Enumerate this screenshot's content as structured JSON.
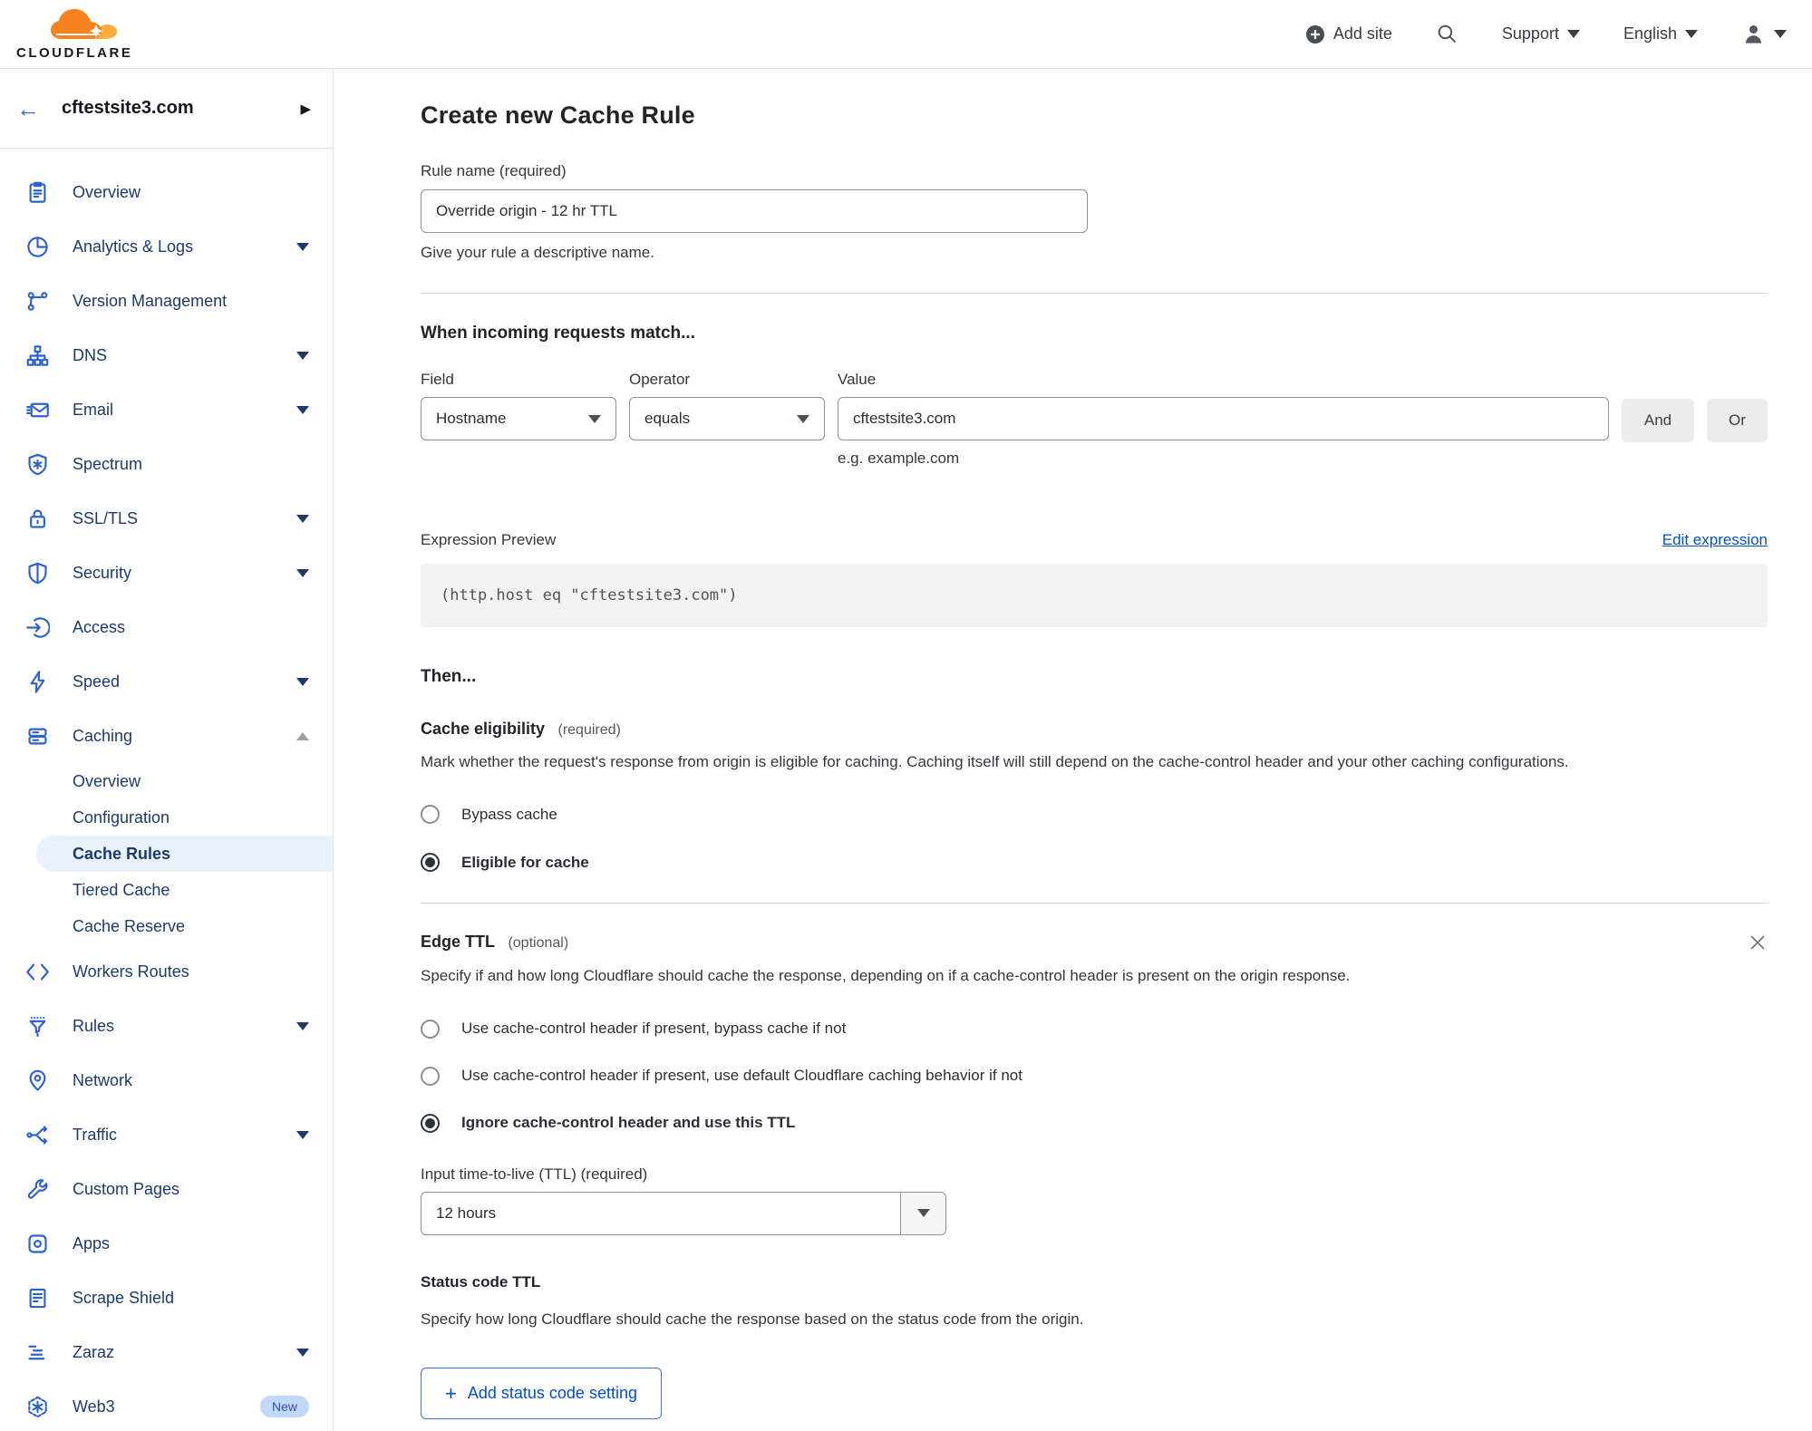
{
  "header": {
    "brand": "CLOUDFLARE",
    "add_site": "Add site",
    "support": "Support",
    "language": "English",
    "icons": {
      "add_site": "plus-circle",
      "search": "magnifier",
      "account": "person",
      "menus": "caret-down"
    }
  },
  "colors": {
    "brand_orange": "#f6821f",
    "brand_orange_light": "#fbad41",
    "link_blue": "#0051c3",
    "nav_text": "#1d3a6d",
    "nav_icon": "#2c63cb",
    "active_item_bg": "#e8f1fc",
    "code_bg": "#f2f2f2"
  },
  "sidebar": {
    "site": "cftestsite3.com",
    "items": [
      {
        "label": "Overview",
        "icon": "clipboard-icon",
        "chevron": "none"
      },
      {
        "label": "Analytics & Logs",
        "icon": "pie-chart-icon",
        "chevron": "down"
      },
      {
        "label": "Version Management",
        "icon": "branch-icon",
        "chevron": "none"
      },
      {
        "label": "DNS",
        "icon": "network-tree-icon",
        "chevron": "down"
      },
      {
        "label": "Email",
        "icon": "envelope-icon",
        "chevron": "down"
      },
      {
        "label": "Spectrum",
        "icon": "shield-asterisk-icon",
        "chevron": "none"
      },
      {
        "label": "SSL/TLS",
        "icon": "padlock-icon",
        "chevron": "down"
      },
      {
        "label": "Security",
        "icon": "shield-icon",
        "chevron": "down"
      },
      {
        "label": "Access",
        "icon": "login-arrow-icon",
        "chevron": "none"
      },
      {
        "label": "Speed",
        "icon": "lightning-icon",
        "chevron": "down"
      },
      {
        "label": "Caching",
        "icon": "server-stack-icon",
        "chevron": "up",
        "expanded": true
      }
    ],
    "caching_sub": [
      {
        "label": "Overview",
        "active": false
      },
      {
        "label": "Configuration",
        "active": false
      },
      {
        "label": "Cache Rules",
        "active": true
      },
      {
        "label": "Tiered Cache",
        "active": false
      },
      {
        "label": "Cache Reserve",
        "active": false
      }
    ],
    "items_after": [
      {
        "label": "Workers Routes",
        "icon": "code-brackets-icon",
        "chevron": "none"
      },
      {
        "label": "Rules",
        "icon": "funnel-icon",
        "chevron": "down"
      },
      {
        "label": "Network",
        "icon": "map-pin-icon",
        "chevron": "none"
      },
      {
        "label": "Traffic",
        "icon": "split-arrows-icon",
        "chevron": "down"
      },
      {
        "label": "Custom Pages",
        "icon": "wrench-icon",
        "chevron": "none"
      },
      {
        "label": "Apps",
        "icon": "app-icon",
        "chevron": "none"
      },
      {
        "label": "Scrape Shield",
        "icon": "document-icon",
        "chevron": "none"
      },
      {
        "label": "Zaraz",
        "icon": "bars-icon",
        "chevron": "down"
      },
      {
        "label": "Web3",
        "icon": "hexagon-icon",
        "chevron": "none",
        "badge": "New"
      }
    ]
  },
  "main": {
    "title": "Create new Cache Rule",
    "rule_name": {
      "label": "Rule name (required)",
      "value": "Override origin - 12 hr TTL",
      "help": "Give your rule a descriptive name."
    },
    "match": {
      "heading": "When incoming requests match...",
      "field_label": "Field",
      "field_value": "Hostname",
      "operator_label": "Operator",
      "operator_value": "equals",
      "value_label": "Value",
      "value_text": "cftestsite3.com",
      "value_help": "e.g. example.com",
      "and_button": "And",
      "or_button": "Or"
    },
    "expression": {
      "label": "Expression Preview",
      "edit_link": "Edit expression",
      "code": "(http.host eq \"cftestsite3.com\")"
    },
    "then_heading": "Then...",
    "eligibility": {
      "heading": "Cache eligibility",
      "required_tag": "(required)",
      "description": "Mark whether the request's response from origin is eligible for caching. Caching itself will still depend on the cache-control header and your other caching configurations.",
      "options": [
        {
          "label": "Bypass cache",
          "selected": false
        },
        {
          "label": "Eligible for cache",
          "selected": true
        }
      ]
    },
    "edge_ttl": {
      "heading": "Edge TTL",
      "optional_tag": "(optional)",
      "description": "Specify if and how long Cloudflare should cache the response, depending on if a cache-control header is present on the origin response.",
      "options": [
        {
          "label": "Use cache-control header if present, bypass cache if not",
          "selected": false
        },
        {
          "label": "Use cache-control header if present, use default Cloudflare caching behavior if not",
          "selected": false
        },
        {
          "label": "Ignore cache-control header and use this TTL",
          "selected": true
        }
      ],
      "ttl_label": "Input time-to-live (TTL) (required)",
      "ttl_value": "12 hours"
    },
    "status_code": {
      "heading": "Status code TTL",
      "description": "Specify how long Cloudflare should cache the response based on the status code from the origin.",
      "add_button": "Add status code setting"
    }
  }
}
